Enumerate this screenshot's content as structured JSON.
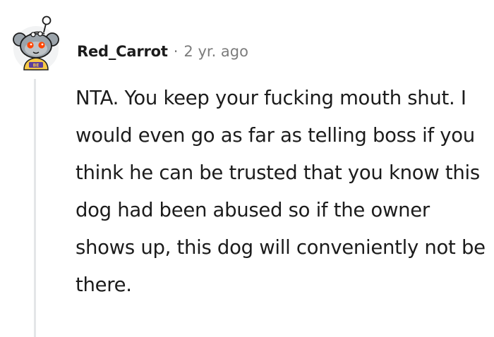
{
  "comment": {
    "author": "Red_Carrot",
    "separator": "·",
    "age": "2 yr. ago",
    "body": "NTA. You keep your fucking mouth shut. I would even go as far as telling boss if you think he can be trusted that you know this dog had been abused so if the owner shows up, this dog will conveniently not be there.",
    "avatar_icon": "snoo-avatar-icon"
  },
  "colors": {
    "text": "#1c1c1c",
    "muted": "#7c7c7c",
    "thread_line": "#e4e6e8",
    "avatar_bg": "#f2f3f4",
    "avatar_head": "#9ba3aa",
    "avatar_accent": "#ff4500",
    "avatar_shirt": "#f7c948"
  }
}
